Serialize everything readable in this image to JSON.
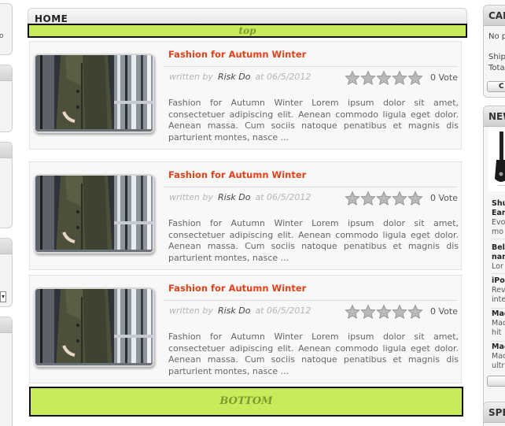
{
  "main": {
    "home_label": "HOME",
    "top_banner": "top",
    "bottom_banner": "BOTTOM",
    "articles": [
      {
        "title": "Fashion for Autumn Winter",
        "written_by": "written by",
        "author": "Risk Do",
        "date": "at 06/5/2012",
        "rating": 0,
        "votes": "0 Vote",
        "excerpt": "Fashion for Autumn Winter Lorem ipsum dolor sit amet, consectetuer adipiscing elit. Aenean commodo ligula eget dolor. Aenean massa. Cum sociis natoque penatibus et magnis dis parturient montes, nasce ..."
      },
      {
        "title": "Fashion for Autumn Winter",
        "written_by": "written by",
        "author": "Risk Do",
        "date": "at 06/5/2012",
        "rating": 0,
        "votes": "0 Vote",
        "excerpt": "Fashion for Autumn Winter Lorem ipsum dolor sit amet, consectetuer adipiscing elit. Aenean commodo ligula eget dolor. Aenean massa. Cum sociis natoque penatibus et magnis dis parturient montes, nasce ..."
      },
      {
        "title": "Fashion for Autumn Winter",
        "written_by": "written by",
        "author": "Risk Do",
        "date": "at 06/5/2012",
        "rating": 0,
        "votes": "0 Vote",
        "excerpt": "Fashion for Autumn Winter Lorem ipsum dolor sit amet, consectetuer adipiscing elit. Aenean commodo ligula eget dolor. Aenean massa. Cum sociis natoque penatibus et magnis dis parturient montes, nasce ..."
      }
    ]
  },
  "left_sidebar": {
    "partial_text": "o"
  },
  "right_sidebar": {
    "cart": {
      "title": "CAR",
      "empty_text": "No p",
      "shipping": "Ship",
      "total": "Tota",
      "button": "C"
    },
    "new": {
      "title": "NEW",
      "items": [
        {
          "name_1": "Shu",
          "name_2": "Ear",
          "desc_1": "Evo",
          "desc_2": "mo"
        },
        {
          "name_1": "Bel",
          "name_2": "nam",
          "desc_1": "Lor"
        },
        {
          "name_1": "iPo",
          "desc_1": "Rev",
          "desc_2": "inte"
        },
        {
          "name_1": "Mac",
          "desc_1": "Mac",
          "desc_2": "hit"
        },
        {
          "name_1": "Mac",
          "desc_1": "Mac",
          "desc_2": "ultr"
        }
      ]
    },
    "special": {
      "title": "SPE"
    }
  },
  "colors": {
    "accent_title": "#e0431a",
    "banner": "#c8eb5b",
    "banner_text": "#7d9a2e"
  }
}
